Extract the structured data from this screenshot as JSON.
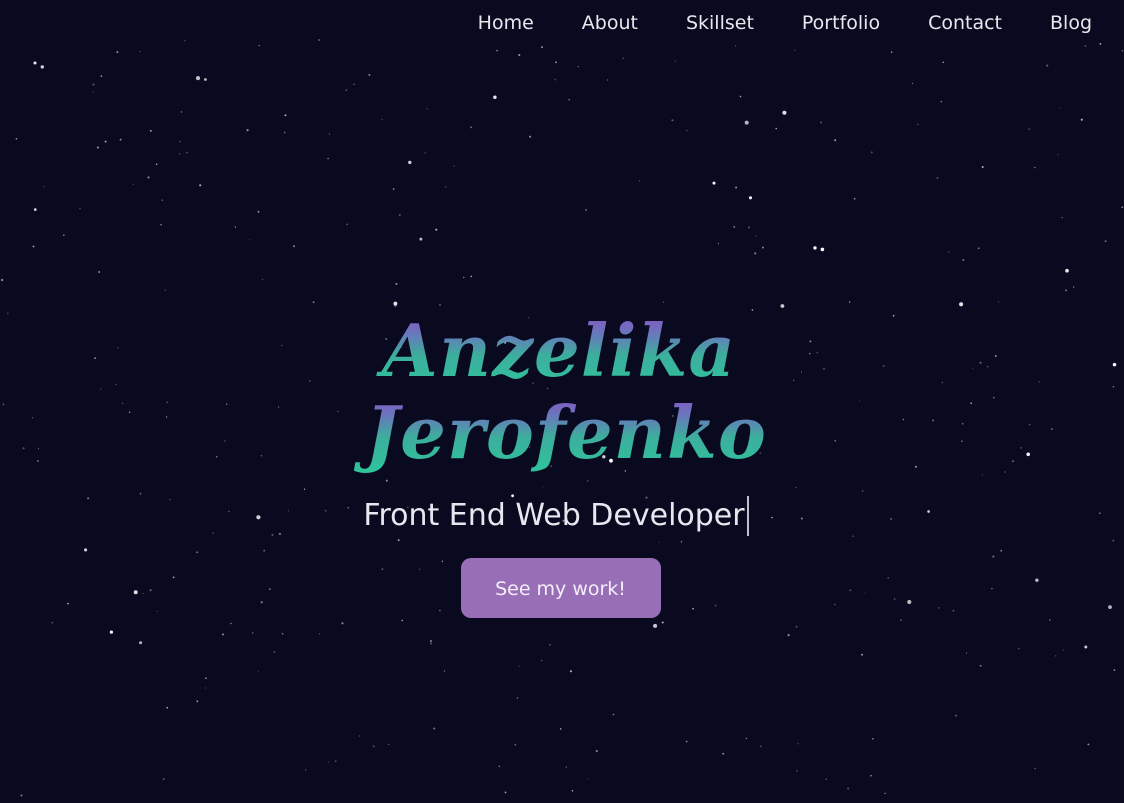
{
  "nav": {
    "items": [
      {
        "label": "Home"
      },
      {
        "label": "About"
      },
      {
        "label": "Skillset"
      },
      {
        "label": "Portfolio"
      },
      {
        "label": "Contact"
      },
      {
        "label": "Blog"
      }
    ]
  },
  "hero": {
    "first_name": "Anzelika",
    "last_name": "Jerofenko",
    "subtitle": "Front End Web Developer",
    "cta_label": "See my work!"
  },
  "colors": {
    "background": "#090a20",
    "gradient_top": "#8d4fc7",
    "gradient_bottom": "#2ec59c",
    "button": "#986fb7",
    "text": "#e8e6ef"
  }
}
